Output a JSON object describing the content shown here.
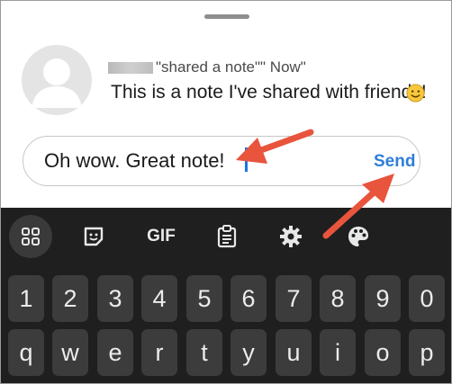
{
  "note": {
    "meta": "\"shared a note\"\" Now\"",
    "text": "This is a note I've shared with friends!",
    "emoji_icon": "slightly-smiling-face-icon"
  },
  "reply": {
    "value": "Oh wow. Great note!",
    "send_label": "Send"
  },
  "keyboard": {
    "toolbar": [
      "apps-grid-icon",
      "sticker-icon",
      "gif-label",
      "clipboard-icon",
      "gear-icon",
      "palette-icon"
    ],
    "gif_label": "GIF",
    "number_row": [
      "1",
      "2",
      "3",
      "4",
      "5",
      "6",
      "7",
      "8",
      "9",
      "0"
    ],
    "letter_row": [
      "q",
      "w",
      "e",
      "r",
      "t",
      "y",
      "u",
      "i",
      "o",
      "p"
    ]
  },
  "colors": {
    "accent": "#2d7ed8",
    "arrow": "#e8543c",
    "keyboard_bg": "#1f1f1f",
    "key_bg": "#3c3c3c"
  }
}
